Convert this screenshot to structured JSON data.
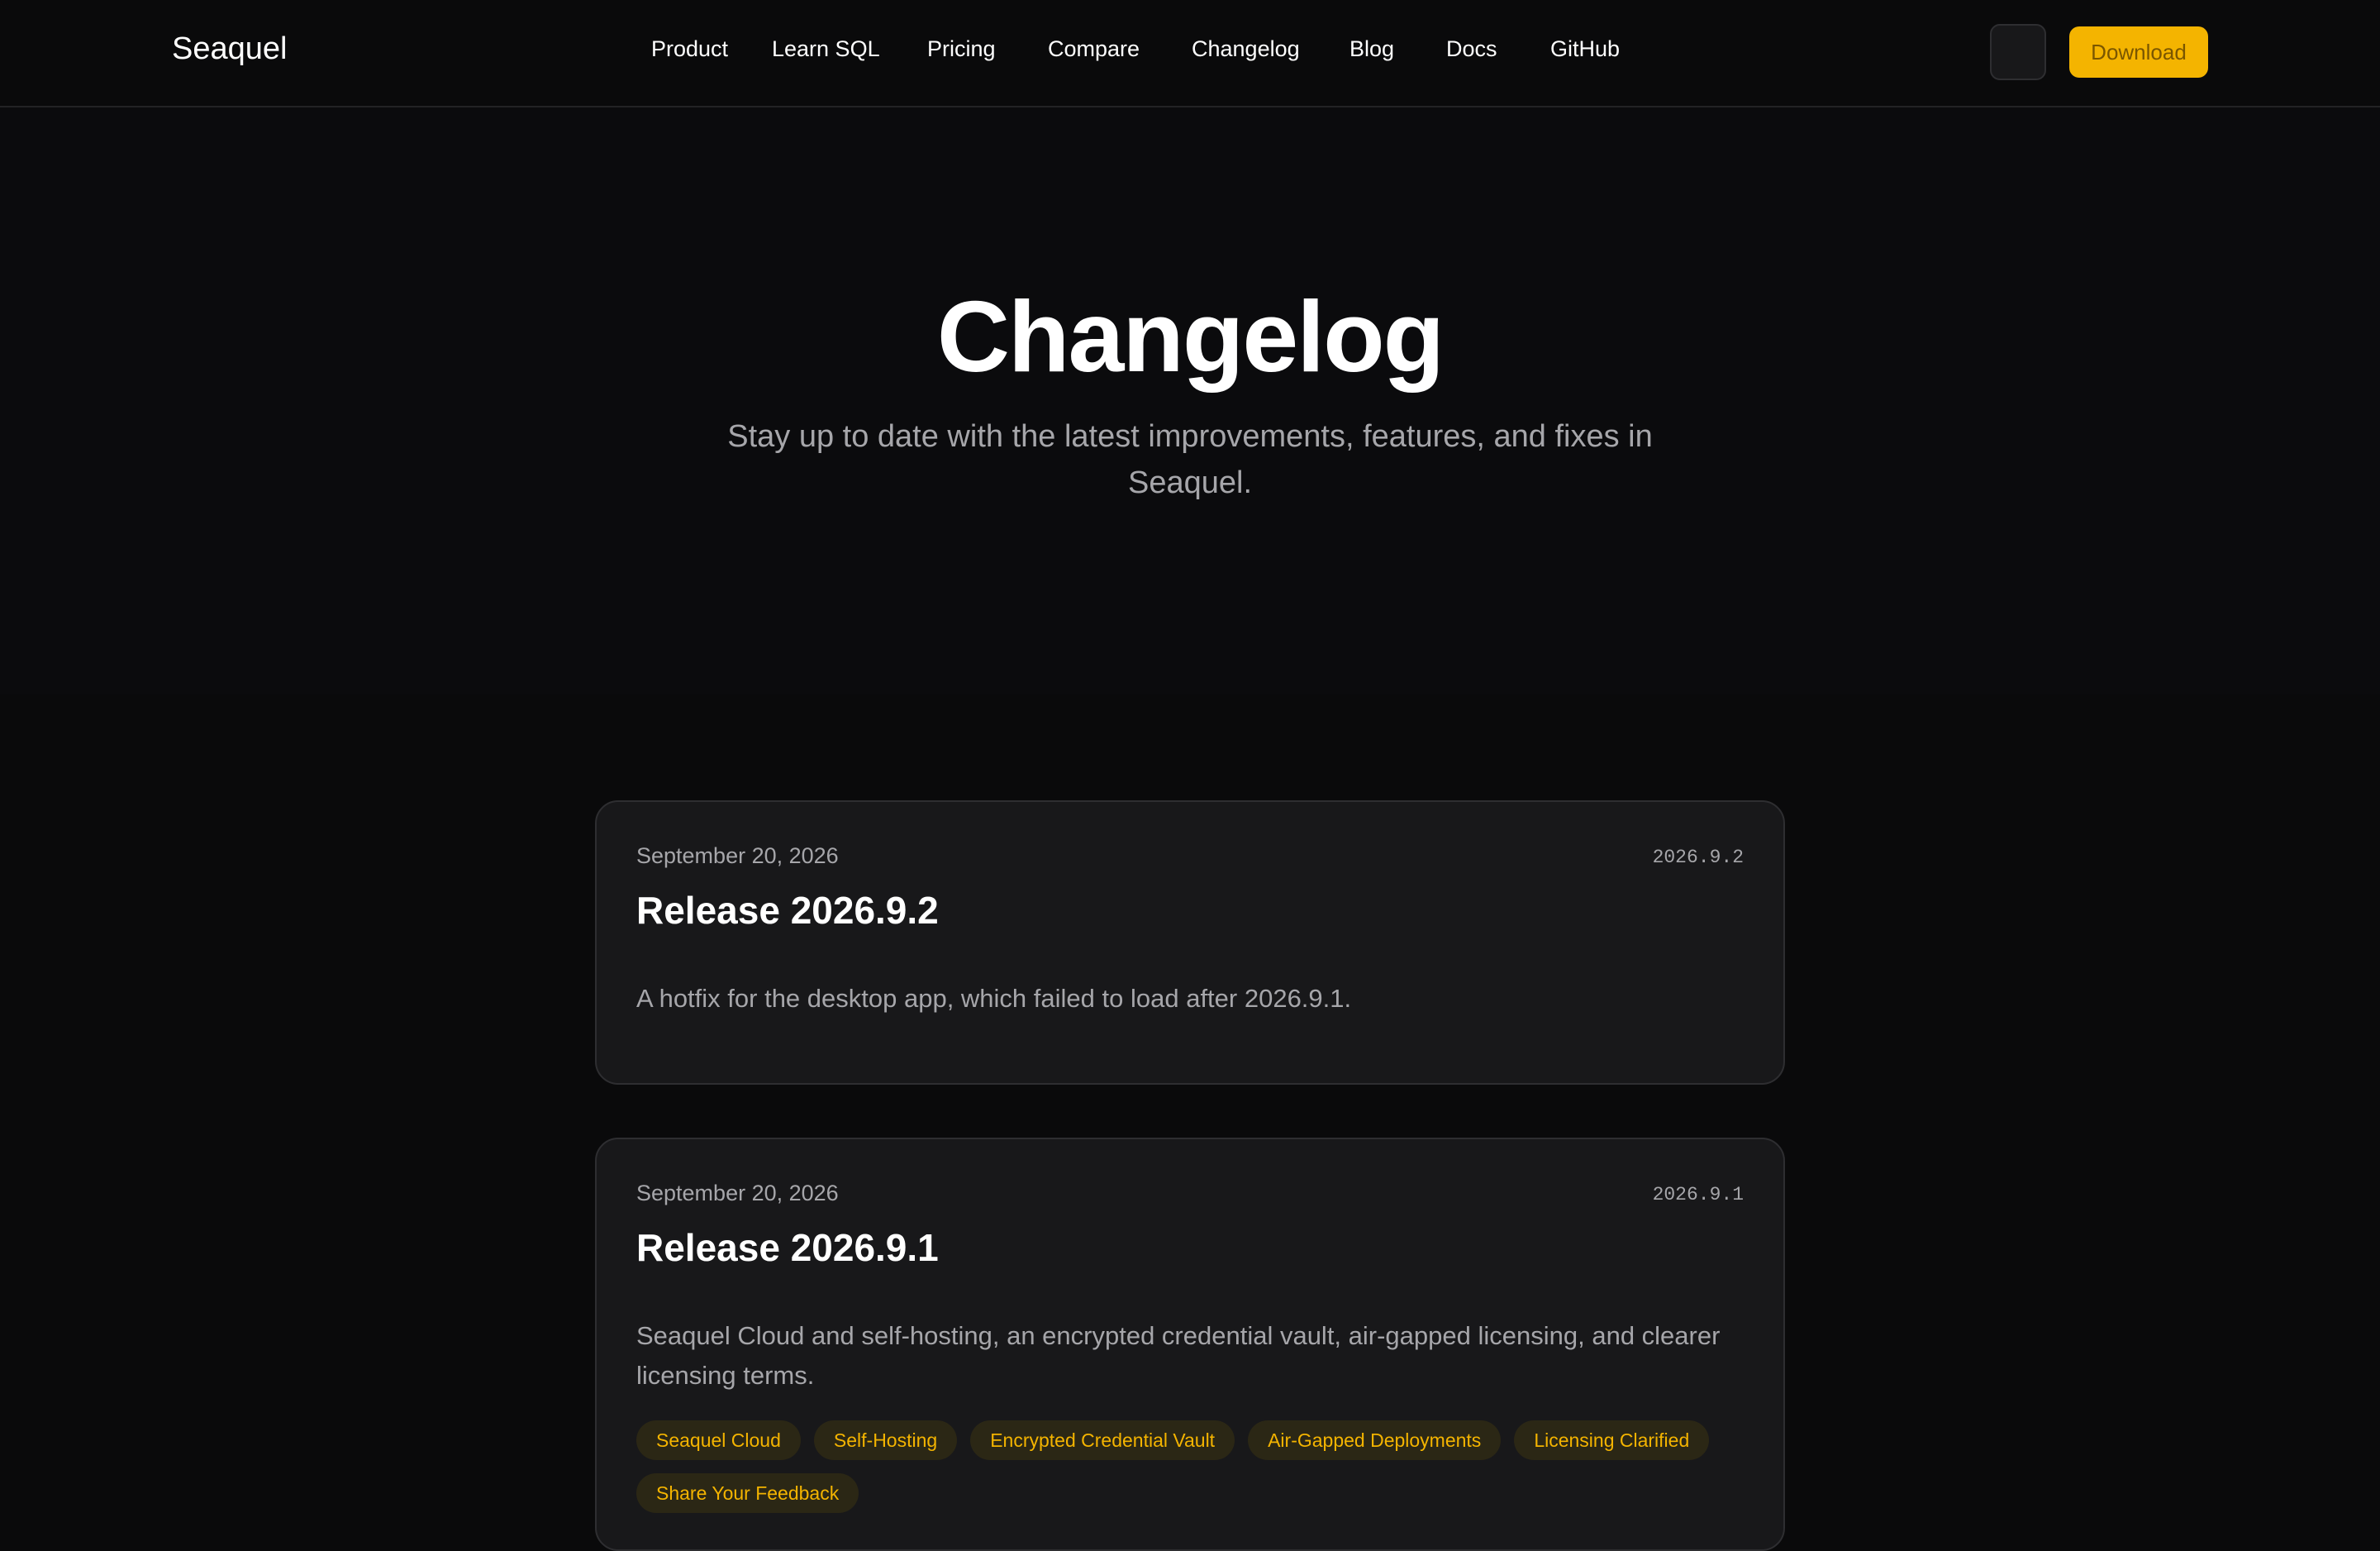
{
  "header": {
    "brand": "Seaquel",
    "nav": [
      "Product",
      "Learn SQL",
      "Pricing",
      "Compare",
      "Changelog",
      "Blog",
      "Docs",
      "GitHub"
    ],
    "download_label": "Download"
  },
  "hero": {
    "title": "Changelog",
    "subtitle": "Stay up to date with the latest improvements, features, and fixes in Seaquel."
  },
  "releases": [
    {
      "date": "September 20, 2026",
      "version": "2026.9.2",
      "title": "Release 2026.9.2",
      "description": "A hotfix for the desktop app, which failed to load after 2026.9.1."
    },
    {
      "date": "September 20, 2026",
      "version": "2026.9.1",
      "title": "Release 2026.9.1",
      "description": "Seaquel Cloud and self-hosting, an encrypted credential vault, air-gapped licensing, and clearer licensing terms.",
      "tags": [
        "Seaquel Cloud",
        "Self-Hosting",
        "Encrypted Credential Vault",
        "Air-Gapped Deployments",
        "Licensing Clarified",
        "Share Your Feedback"
      ]
    }
  ],
  "colors": {
    "background": "#0a0a0b",
    "card": "#18181a",
    "accent": "#f4b400",
    "muted_text": "#a6a6aa"
  }
}
